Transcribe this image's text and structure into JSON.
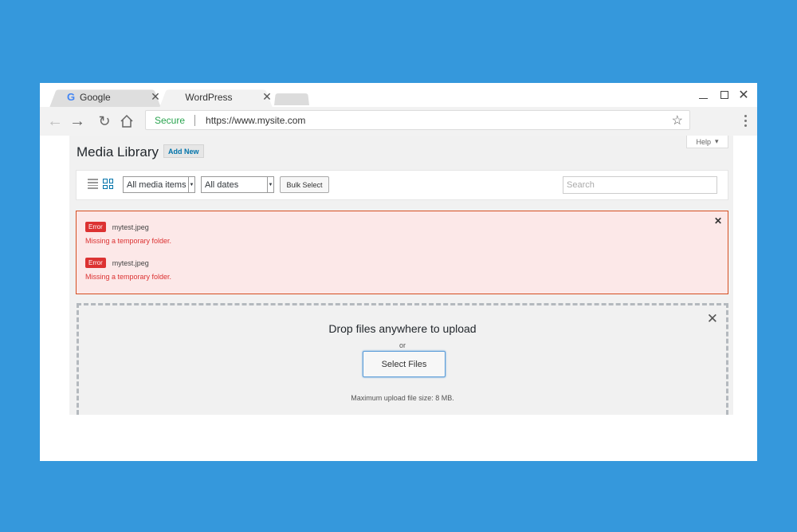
{
  "browser": {
    "tabs": [
      {
        "label": "Google",
        "icon": "google-icon"
      },
      {
        "label": "WordPress"
      }
    ],
    "secure_label": "Secure",
    "url": "https://www.mysite.com"
  },
  "page": {
    "help_label": "Help",
    "title": "Media Library",
    "add_new_label": "Add New"
  },
  "filters": {
    "media_type": "All media items",
    "date": "All dates",
    "bulk_select_label": "Bulk Select",
    "search_placeholder": "Search"
  },
  "errors": [
    {
      "badge": "Error",
      "file": "mytest.jpeg",
      "message": "Missing a temporary folder."
    },
    {
      "badge": "Error",
      "file": "mytest.jpeg",
      "message": "Missing a temporary folder."
    }
  ],
  "uploader": {
    "title": "Drop files anywhere to upload",
    "or_text": "or",
    "button_label": "Select Files",
    "max_size_text": "Maximum upload file size: 8 MB."
  },
  "colors": {
    "background": "#3598dc",
    "link": "#0073aa",
    "error": "#dc3232",
    "secure": "#2aa44f"
  }
}
